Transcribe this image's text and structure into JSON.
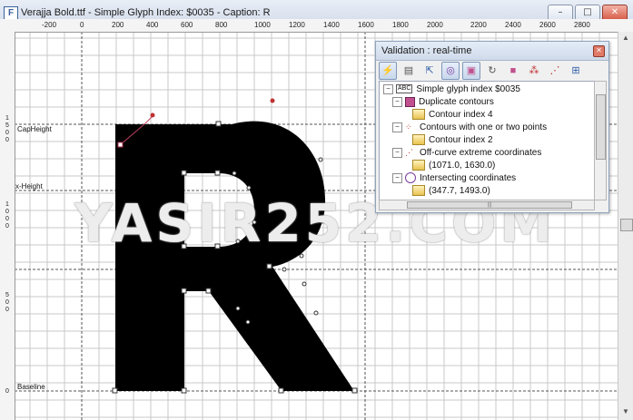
{
  "window": {
    "title": "Verajja Bold.ttf - Simple Glyph Index: $0035 - Caption: R",
    "app_icon": "F",
    "buttons": {
      "minimize": "–",
      "maximize": "□",
      "close": "✕"
    }
  },
  "ruler": {
    "top_ticks": [
      "-200",
      "0",
      "200",
      "400",
      "600",
      "800",
      "1000",
      "1200",
      "1400",
      "1600",
      "1800",
      "2000",
      "2200",
      "2400",
      "2600",
      "2800"
    ],
    "left_labels": [
      {
        "chars": [
          "1",
          "5",
          "0",
          "0"
        ]
      },
      {
        "chars": [
          "1",
          "0",
          "0",
          "0"
        ]
      },
      {
        "chars": [
          "5",
          "0",
          "0"
        ]
      },
      {
        "chars": [
          "0"
        ]
      }
    ]
  },
  "metrics": {
    "capheight": "CapHeight",
    "xheight": "x-Height",
    "baseline": "Baseline"
  },
  "watermark": "YASIR252.COM",
  "validation": {
    "title": "Validation : real-time",
    "close": "✕",
    "toolbar_icons": [
      "lightning-icon",
      "copy-icon",
      "export-icon",
      "intersect-icon",
      "selected-icon",
      "refresh-icon",
      "contour-icon",
      "points-icon",
      "extreme-icon",
      "grid-icon"
    ],
    "tree": [
      {
        "level": 0,
        "expander": "−",
        "icon": "abc",
        "label": "Simple glyph index $0035"
      },
      {
        "level": 1,
        "expander": "−",
        "icon": "square",
        "label": "Duplicate contours"
      },
      {
        "level": 2,
        "expander": "",
        "icon": "sub",
        "label": "Contour index 4"
      },
      {
        "level": 1,
        "expander": "−",
        "icon": "points",
        "label": "Contours with one or two points"
      },
      {
        "level": 2,
        "expander": "",
        "icon": "sub",
        "label": "Contour index 2"
      },
      {
        "level": 1,
        "expander": "−",
        "icon": "points",
        "label": "Off-curve extreme coordinates"
      },
      {
        "level": 2,
        "expander": "",
        "icon": "sub",
        "label": "(1071.0, 1630.0)"
      },
      {
        "level": 1,
        "expander": "−",
        "icon": "circle",
        "label": "Intersecting coordinates"
      },
      {
        "level": 2,
        "expander": "",
        "icon": "sub",
        "label": "(347.7, 1493.0)"
      }
    ]
  }
}
